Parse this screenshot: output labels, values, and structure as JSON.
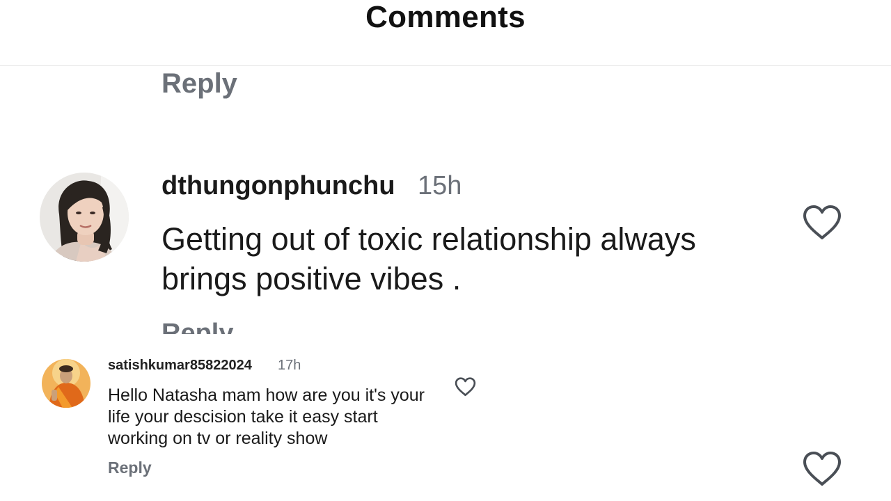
{
  "header": {
    "title": "Comments"
  },
  "top_reply_label": "Reply",
  "comments": [
    {
      "username": "dthungonphunchu",
      "time": "15h",
      "text": "Getting out of toxic relationship always brings positive vibes .",
      "reply_label": "Reply",
      "avatar_icon": "woman-portrait-avatar",
      "like_icon": "heart-outline-icon"
    },
    {
      "username": "satishkumar85822024",
      "time": "17h",
      "text": "Hello Natasha mam how are you it's your life your descision take it easy start working on tv or reality show",
      "reply_label": "Reply",
      "avatar_icon": "orange-robed-figure-avatar",
      "like_icon": "heart-outline-icon"
    }
  ],
  "colors": {
    "text": "#1a1a1a",
    "secondary": "#6b7078",
    "divider": "#e6e6e6",
    "background": "#ffffff"
  }
}
